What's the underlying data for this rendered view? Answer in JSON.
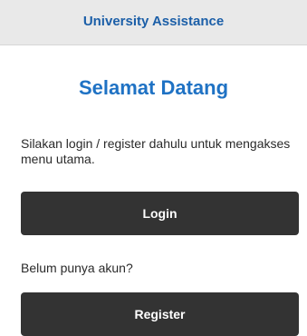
{
  "header": {
    "title": "University Assistance"
  },
  "main": {
    "welcome_title": "Selamat Datang",
    "instruction_text": "Silakan login / register dahulu untuk mengakses menu utama.",
    "login_button_label": "Login",
    "no_account_text": "Belum punya akun?",
    "register_button_label": "Register"
  },
  "colors": {
    "header_background": "#e9e9e9",
    "header_title": "#1c5fa8",
    "welcome_title": "#1f72c4",
    "button_background": "#333333",
    "button_text": "#ffffff"
  }
}
